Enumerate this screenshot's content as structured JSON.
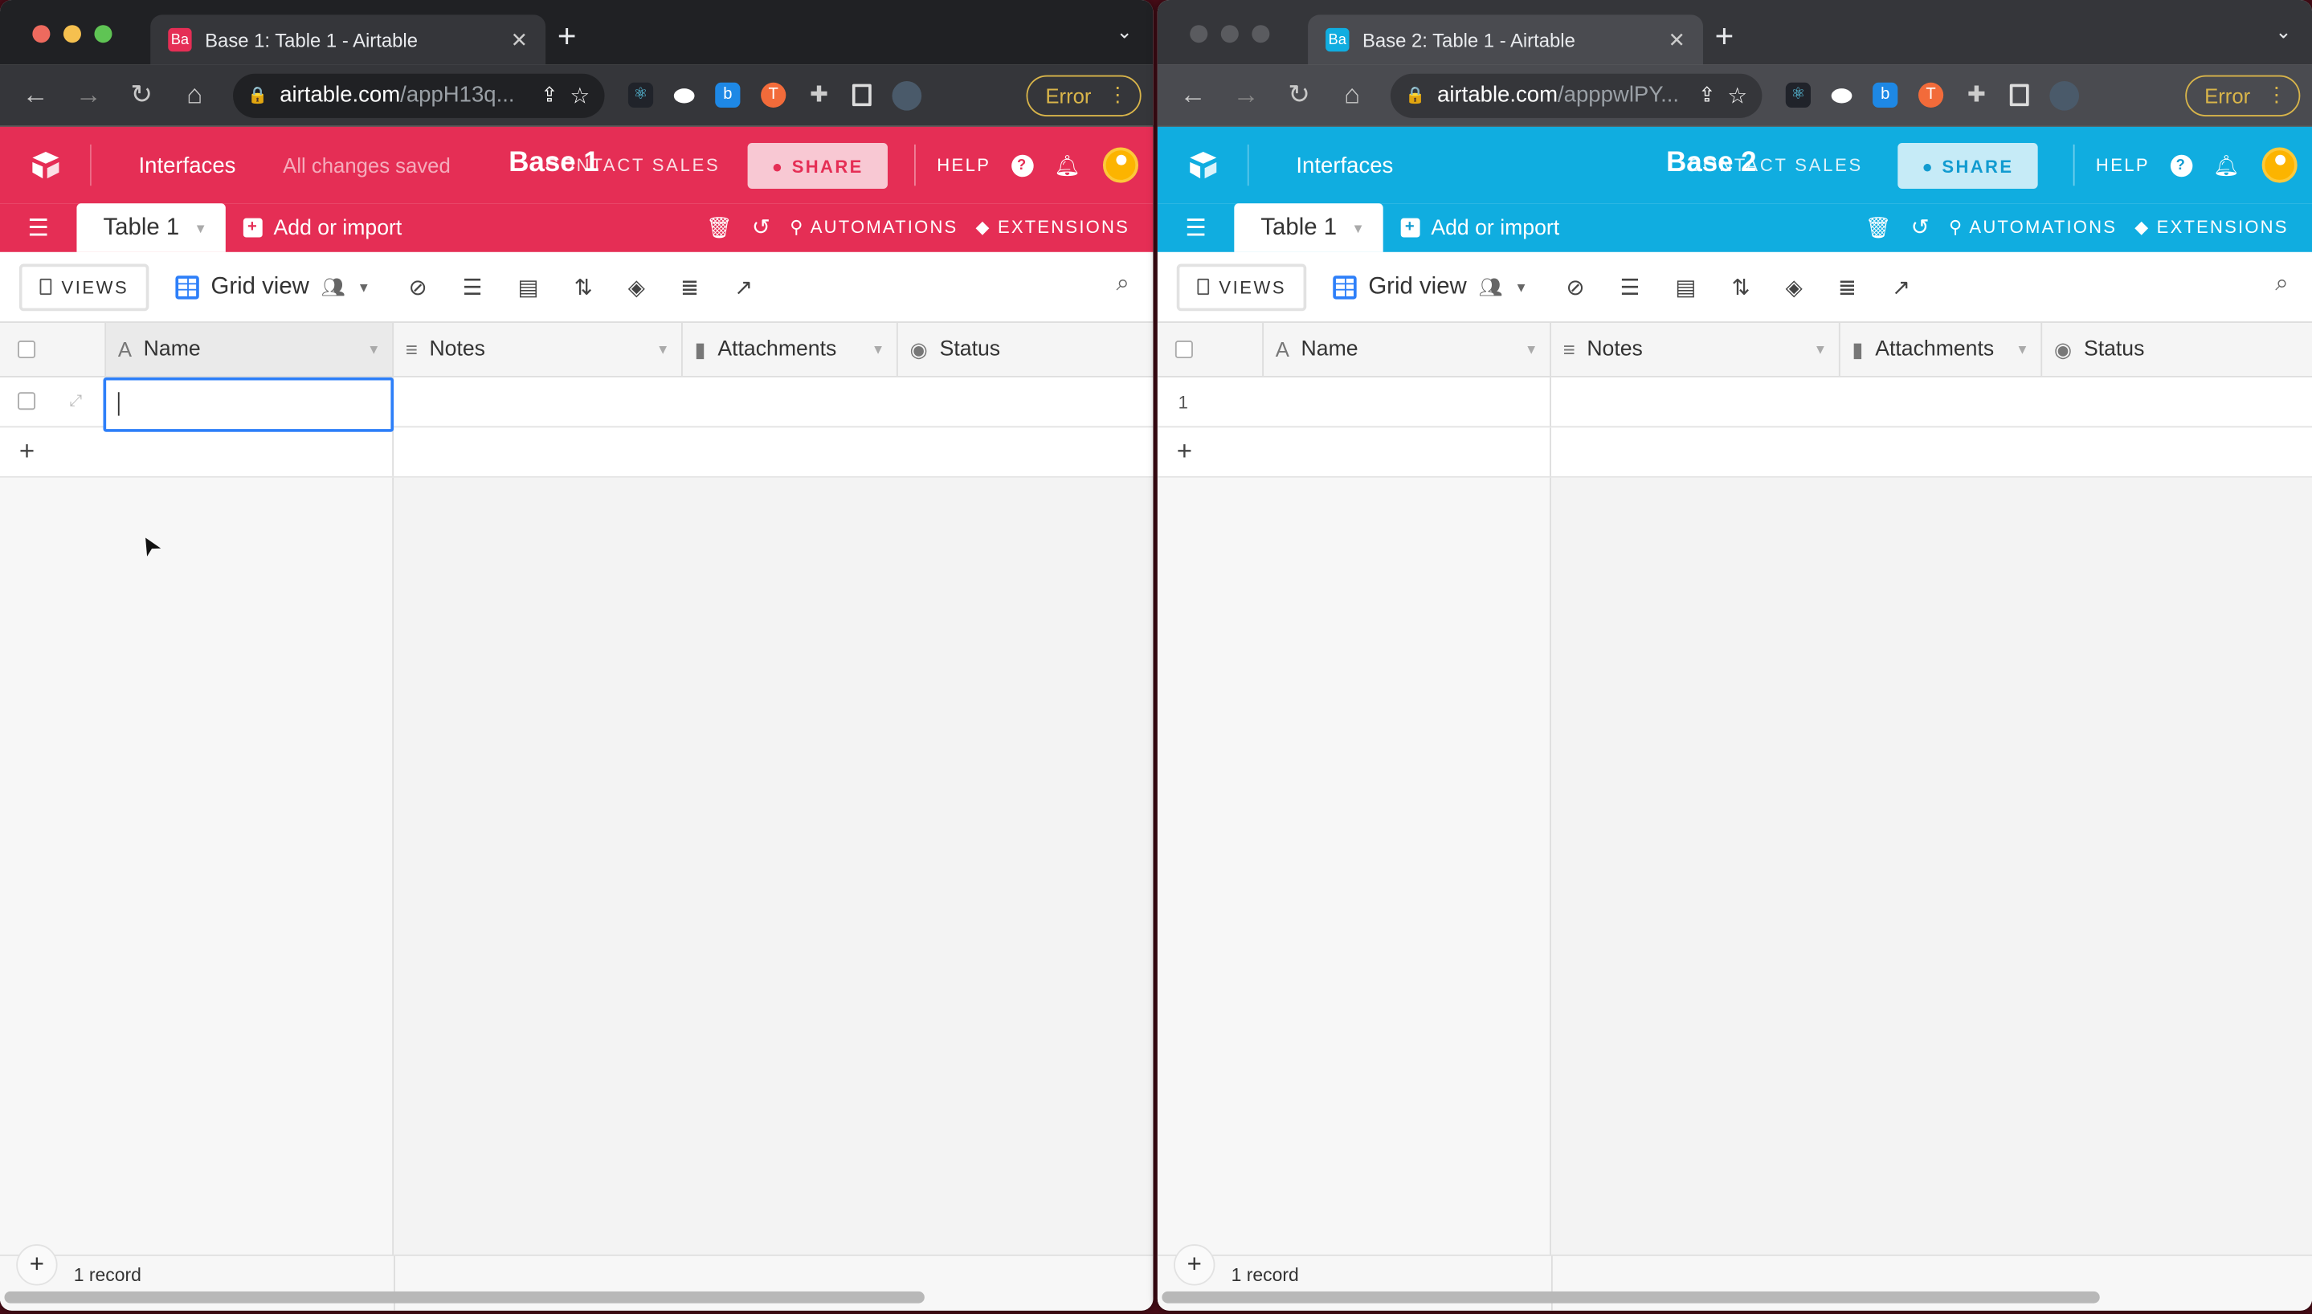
{
  "windows": [
    {
      "tab_title": "Base 1: Table 1 - Airtable",
      "favicon": "Ba",
      "url_host": "airtable.com",
      "url_path": "/appH13q...",
      "error_label": "Error",
      "brand_color": "#e52e55",
      "interfaces": "Interfaces",
      "saved_status": "All changes saved",
      "base_name": "Base 1",
      "contact_sales": "CONTACT SALES",
      "share": "SHARE",
      "help": "HELP",
      "table_tab": "Table 1",
      "add_import": "Add or import",
      "automations": "AUTOMATIONS",
      "extensions": "EXTENSIONS",
      "views": "VIEWS",
      "view_name": "Grid view",
      "columns": [
        "Name",
        "Notes",
        "Attachments",
        "Status"
      ],
      "row_number": "",
      "editing": true,
      "record_count": "1 record"
    },
    {
      "tab_title": "Base 2: Table 1 - Airtable",
      "favicon": "Ba",
      "url_host": "airtable.com",
      "url_path": "/apppwlPY...",
      "error_label": "Error",
      "brand_color": "#10ade0",
      "interfaces": "Interfaces",
      "saved_status": "",
      "base_name": "Base 2",
      "contact_sales": "CONTACT SALES",
      "share": "SHARE",
      "help": "HELP",
      "table_tab": "Table 1",
      "add_import": "Add or import",
      "automations": "AUTOMATIONS",
      "extensions": "EXTENSIONS",
      "views": "VIEWS",
      "view_name": "Grid view",
      "columns": [
        "Name",
        "Notes",
        "Attachments",
        "Status"
      ],
      "row_number": "1",
      "editing": false,
      "record_count": "1 record"
    }
  ]
}
